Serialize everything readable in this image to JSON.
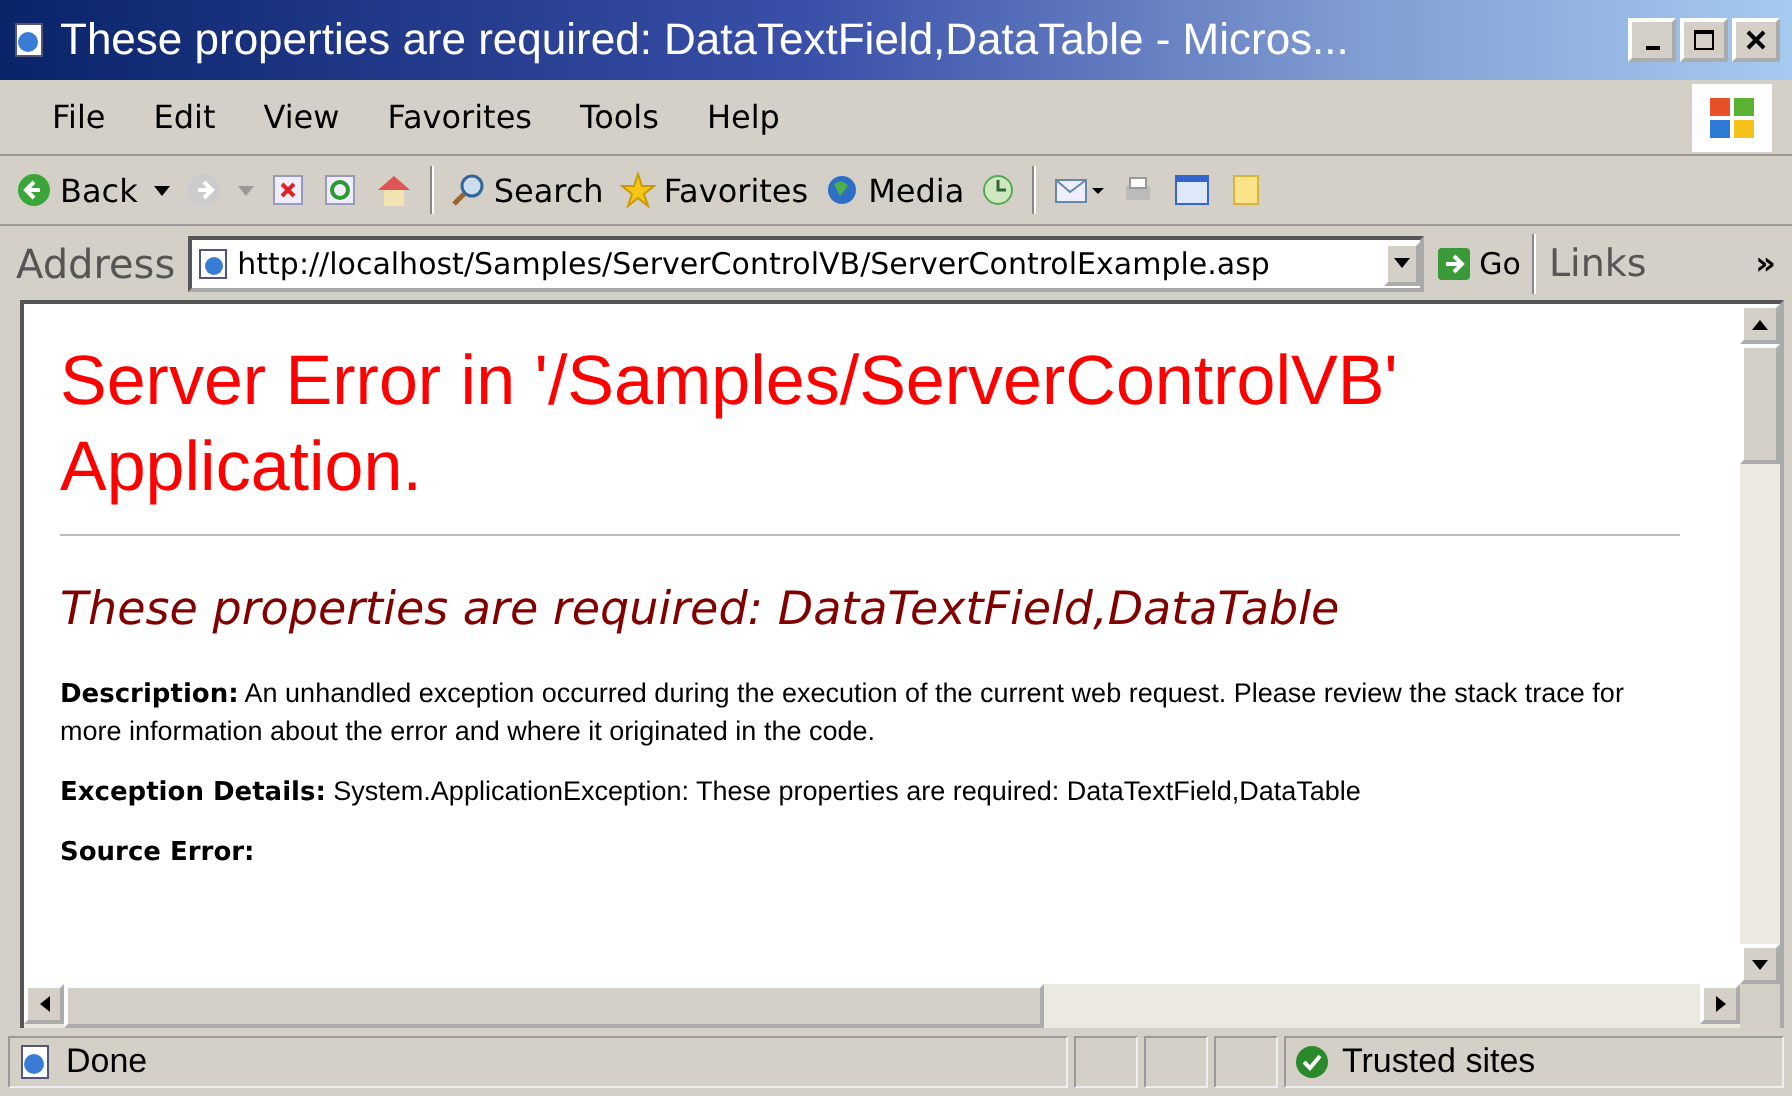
{
  "window": {
    "title": "These properties are required: DataTextField,DataTable - Micros..."
  },
  "menu": [
    "File",
    "Edit",
    "View",
    "Favorites",
    "Tools",
    "Help"
  ],
  "toolbar": {
    "back": "Back",
    "search": "Search",
    "favorites": "Favorites",
    "media": "Media"
  },
  "address": {
    "label": "Address",
    "value": "http://localhost/Samples/ServerControlVB/ServerControlExample.asp",
    "go": "Go",
    "links": "Links",
    "more": "»"
  },
  "page": {
    "heading": "Server Error in '/Samples/ServerControlVB' Application.",
    "error": "These properties are required: DataTextField,DataTable",
    "paragraphs": [
      "**Description:** An unhandled exception occurred during the execution of the current web request. Please review the stack trace for more information about the error and where it originated in the code.",
      "**Exception Details:** System.ApplicationException: These properties are required: DataTextField,DataTable"
    ],
    "section": "Source Error:"
  },
  "status_bar": {
    "text": "Done",
    "zone": "Trusted sites"
  }
}
